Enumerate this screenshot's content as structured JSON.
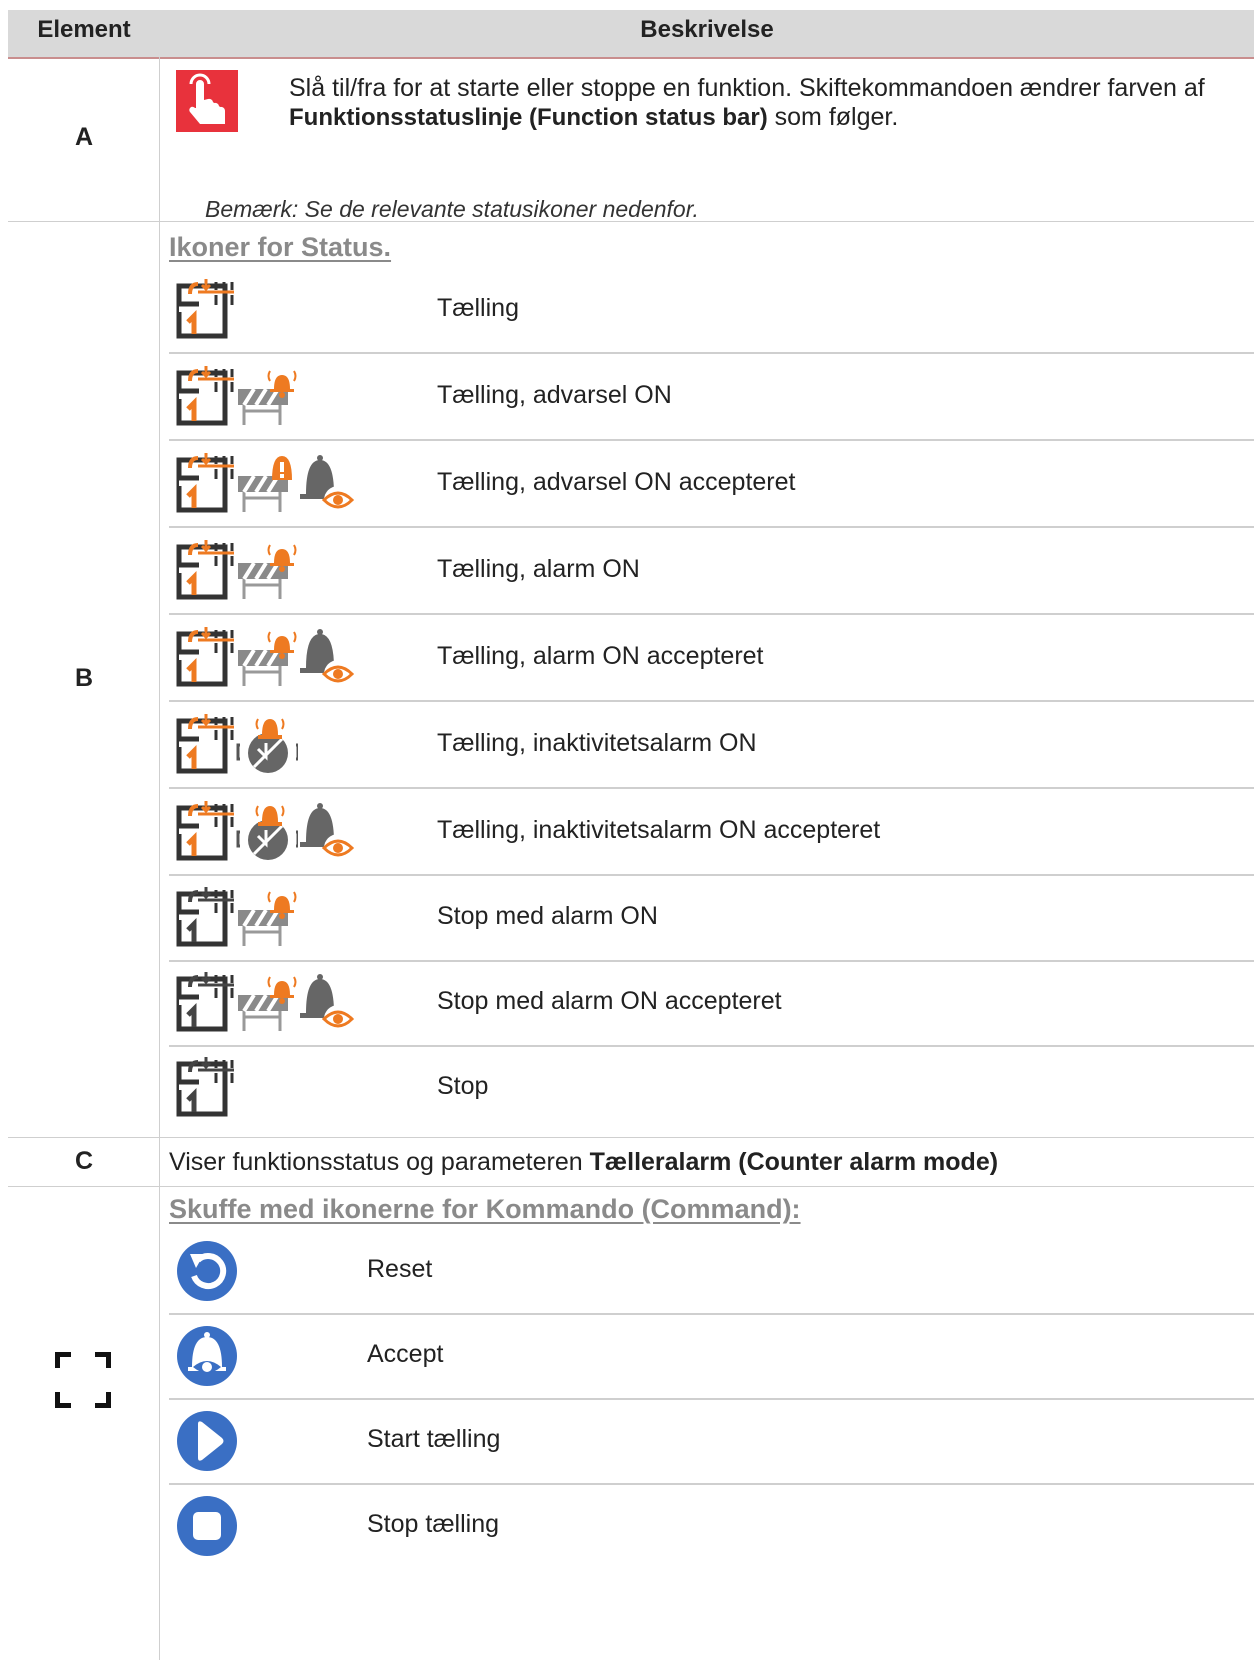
{
  "table": {
    "header": {
      "element": "Element",
      "description": "Beskrivelse"
    },
    "row_a": {
      "letter": "A",
      "icon": "touch-toggle-icon",
      "text_part1": "Slå til/fra for at starte eller stoppe en funktion. Skiftekommandoen ændrer farven af",
      "text_bold": "Funktionsstatuslinje (Function status bar)",
      "text_part2": "som følger.",
      "note": "Bemærk: Se de relevante statusikoner nedenfor."
    },
    "row_b": {
      "letter": "B",
      "section_title": "Ikoner for Status.",
      "items": [
        {
          "label": "Tælling",
          "icons": [
            "counter-icon"
          ]
        },
        {
          "label": "Tælling, advarsel ON",
          "icons": [
            "counter-icon",
            "barrier-bell-icon"
          ]
        },
        {
          "label": "Tælling, advarsel ON accepteret",
          "icons": [
            "counter-icon",
            "barrier-warning-icon",
            "bell-eye-icon"
          ]
        },
        {
          "label": "Tælling, alarm ON",
          "icons": [
            "counter-icon",
            "barrier-bell-icon"
          ]
        },
        {
          "label": "Tælling, alarm ON accepteret",
          "icons": [
            "counter-icon",
            "barrier-bell-icon",
            "bell-eye-icon"
          ]
        },
        {
          "label": "Tælling, inaktivitetsalarm ON",
          "icons": [
            "counter-icon",
            "inactivity-alarm-icon"
          ]
        },
        {
          "label": "Tælling, inaktivitetsalarm ON accepteret",
          "icons": [
            "counter-icon",
            "inactivity-alarm-icon",
            "bell-eye-icon"
          ]
        },
        {
          "label": "Stop med alarm ON",
          "icons": [
            "counter-stopped-icon",
            "barrier-bell-icon"
          ]
        },
        {
          "label": "Stop med alarm ON accepteret",
          "icons": [
            "counter-stopped-icon",
            "barrier-bell-icon",
            "bell-eye-icon"
          ]
        },
        {
          "label": "Stop",
          "icons": [
            "counter-stopped-icon"
          ]
        }
      ]
    },
    "row_c": {
      "letter": "C",
      "text_part1": "Viser funktionsstatus og parameteren",
      "text_bold": "Tælleralarm (Counter alarm mode)"
    },
    "row_d": {
      "icon": "expand-corners-icon",
      "section_title": "Skuffe med ikonerne for Kommando (Command):",
      "items": [
        {
          "label": "Reset",
          "icon": "reset-icon"
        },
        {
          "label": "Accept",
          "icon": "accept-bell-icon"
        },
        {
          "label": "Start tælling",
          "icon": "play-icon"
        },
        {
          "label": "Stop tælling",
          "icon": "stop-icon"
        }
      ]
    }
  },
  "colors": {
    "accent_red": "#e8323c",
    "orange": "#ee7a21",
    "blue": "#3a6fc4",
    "header_bg": "#d9d9d9"
  }
}
